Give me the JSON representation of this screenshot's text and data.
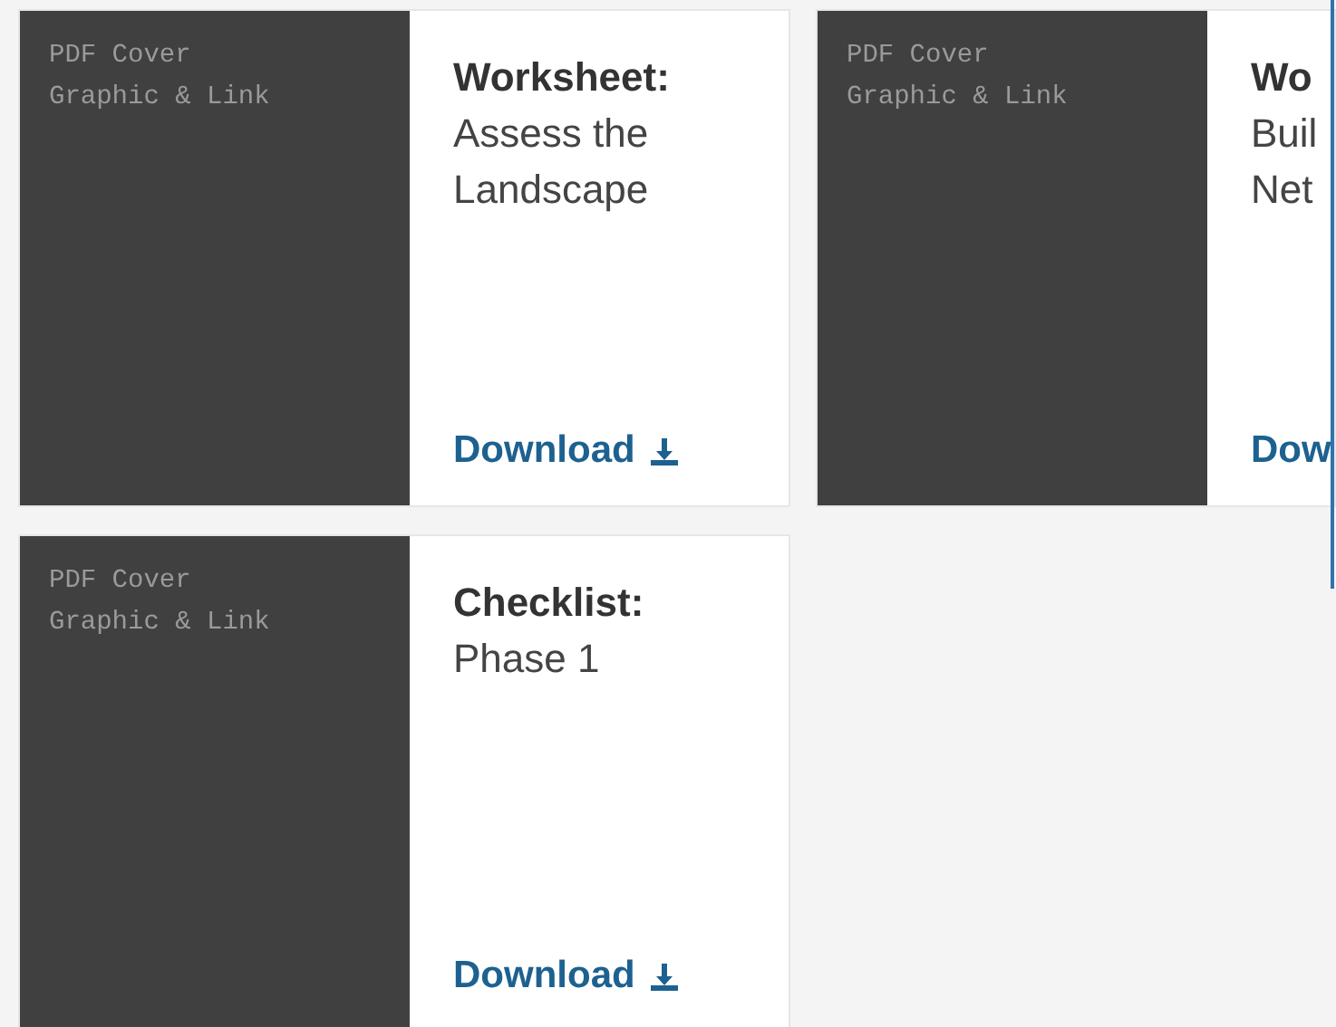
{
  "cards": [
    {
      "cover_text": [
        "PDF Cover",
        "Graphic & Link"
      ],
      "title": "Worksheet:",
      "subtitle_lines": [
        "Assess the",
        "Landscape"
      ],
      "link": "Download",
      "download_icon": true
    },
    {
      "cover_text": [
        "PDF Cover",
        "Graphic & Link"
      ],
      "title": "Wo",
      "subtitle_lines": [
        "Buil",
        "Net"
      ],
      "link": "Dow",
      "download_icon": false
    },
    {
      "cover_text": [
        "PDF Cover",
        "Graphic & Link"
      ],
      "title": "Checklist:",
      "subtitle_lines": [
        "Phase 1"
      ],
      "link": "Download",
      "download_icon": true
    }
  ]
}
